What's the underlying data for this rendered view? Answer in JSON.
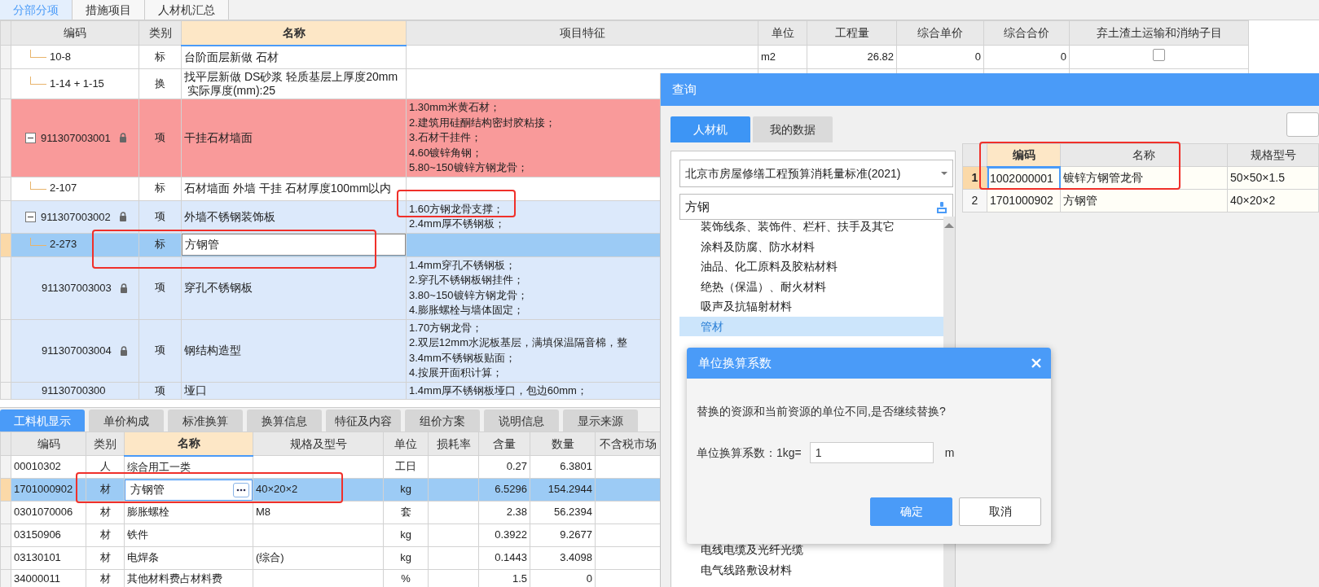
{
  "top_tabs": [
    {
      "label": "分部分项",
      "selected": true
    },
    {
      "label": "措施项目",
      "selected": false
    },
    {
      "label": "人材机汇总",
      "selected": false
    }
  ],
  "main_grid": {
    "columns": [
      {
        "label": "编码",
        "highlighted": false
      },
      {
        "label": "类别",
        "highlighted": false
      },
      {
        "label": "名称",
        "highlighted": true
      },
      {
        "label": "项目特征",
        "highlighted": false
      },
      {
        "label": "单位",
        "highlighted": false
      },
      {
        "label": "工程量",
        "highlighted": false
      },
      {
        "label": "综合单价",
        "highlighted": false
      },
      {
        "label": "综合合价",
        "highlighted": false
      },
      {
        "label": "弃土渣土运输和消纳子目",
        "highlighted": false
      }
    ],
    "rows": [
      {
        "kind": "sub",
        "code": "10-8",
        "type": "标",
        "name": "台阶面层新做 石材",
        "unit": "m2",
        "quantity": "26.82",
        "unit_price": "0",
        "total_price": "0",
        "checked": false,
        "selected": false
      },
      {
        "kind": "sub",
        "code": "1-14 + 1-15",
        "type": "换",
        "name": "找平层新做 DS砂浆 轻质基层上厚度20mm\n 实际厚度(mm):25",
        "selected": false
      },
      {
        "kind": "item",
        "code": "911307003001",
        "type": "项",
        "name": "干挂石材墙面",
        "features": [
          "1.30mm米黄石材；",
          "2.建筑用硅酮结构密封胶粘接；",
          "3.石材干挂件；",
          "4.60镀锌角钢；",
          "5.80~150镀锌方钢龙骨；"
        ],
        "locked": true,
        "expanded": true,
        "color": "#f99a9a",
        "selected": false,
        "children": [
          {
            "kind": "sub",
            "code": "2-107",
            "type": "标",
            "name": "石材墙面 外墙 干挂 石材厚度100mm以内",
            "selected": false
          }
        ]
      },
      {
        "kind": "item",
        "code": "911307003002",
        "type": "项",
        "name": "外墙不锈钢装饰板",
        "features": [
          "1.60方钢龙骨支撑；",
          "2.4mm厚不锈钢板；"
        ],
        "locked": true,
        "expanded": true,
        "color": "#dce9fb",
        "selected": false,
        "children": [
          {
            "kind": "sub",
            "code": "2-273",
            "type": "标",
            "name": "方钢管",
            "editing": true,
            "selected": true
          }
        ]
      },
      {
        "kind": "item",
        "code": "911307003003",
        "type": "项",
        "name": "穿孔不锈钢板",
        "features": [
          "1.4mm穿孔不锈钢板；",
          "2.穿孔不锈钢板钢挂件；",
          "3.80~150镀锌方钢龙骨；",
          "4.膨胀螺栓与墙体固定；"
        ],
        "locked": true,
        "color": "#dce9fb",
        "selected": false
      },
      {
        "kind": "item",
        "code": "911307003004",
        "type": "项",
        "name": "钢结构造型",
        "features": [
          "1.70方钢龙骨；",
          "2.双层12mm水泥板基层，满填保温隔音棉，整",
          "3.4mm不锈钢板贴面；",
          "4.按展开面积计算；"
        ],
        "locked": true,
        "color": "#dce9fb",
        "selected": false
      },
      {
        "kind": "item",
        "code": "91130700300",
        "type": "项",
        "name": "垭口",
        "features": [
          "1.4mm厚不锈钢板垭口，包边60mm；"
        ],
        "color": "#dce9fb",
        "selected": false
      }
    ]
  },
  "detail_tabs": [
    {
      "label": "工料机显示",
      "selected": true
    },
    {
      "label": "单价构成",
      "selected": false
    },
    {
      "label": "标准换算",
      "selected": false
    },
    {
      "label": "换算信息",
      "selected": false
    },
    {
      "label": "特征及内容",
      "selected": false
    },
    {
      "label": "组价方案",
      "selected": false
    },
    {
      "label": "说明信息",
      "selected": false
    },
    {
      "label": "显示来源",
      "selected": false
    }
  ],
  "detail_grid": {
    "columns": [
      {
        "label": "编码",
        "highlighted": false
      },
      {
        "label": "类别",
        "highlighted": false
      },
      {
        "label": "名称",
        "highlighted": true
      },
      {
        "label": "规格及型号",
        "highlighted": false
      },
      {
        "label": "单位",
        "highlighted": false
      },
      {
        "label": "损耗率",
        "highlighted": false
      },
      {
        "label": "含量",
        "highlighted": false
      },
      {
        "label": "数量",
        "highlighted": false
      },
      {
        "label": "不含税市场",
        "highlighted": false
      }
    ],
    "rows": [
      {
        "code": "00010302",
        "type": "人",
        "name": "综合用工一类",
        "unit": "工日",
        "content": "0.27",
        "quantity": "6.3801",
        "selected": false
      },
      {
        "code": "1701000902",
        "type": "材",
        "name": "方钢管",
        "spec": "40×20×2",
        "unit": "kg",
        "content": "6.5296",
        "quantity": "154.2944",
        "editing": true,
        "selected": true
      },
      {
        "code": "0301070006",
        "type": "材",
        "name": "膨胀螺栓",
        "spec": "M8",
        "unit": "套",
        "content": "2.38",
        "quantity": "56.2394",
        "selected": false
      },
      {
        "code": "03150906",
        "type": "材",
        "name": "铁件",
        "unit": "kg",
        "content": "0.3922",
        "quantity": "9.2677",
        "selected": false
      },
      {
        "code": "03130101",
        "type": "材",
        "name": "电焊条",
        "spec": "(综合)",
        "unit": "kg",
        "content": "0.1443",
        "quantity": "3.4098",
        "selected": false
      },
      {
        "code": "34000011",
        "type": "材",
        "name": "其他材料费占材料费",
        "unit": "%",
        "content": "1.5",
        "quantity": "0",
        "selected": false
      }
    ]
  },
  "query_dialog": {
    "title": "查询",
    "tabs": [
      {
        "label": "人材机",
        "selected": true
      },
      {
        "label": "我的数据",
        "selected": false
      }
    ],
    "library": "北京市房屋修缮工程预算消耗量标准(2021)",
    "search": "方钢",
    "categories_above": [
      {
        "label": "装饰线条、装饰件、栏杆、扶手及其它",
        "selected": false
      },
      {
        "label": "涂料及防腐、防水材料",
        "selected": false
      },
      {
        "label": "油品、化工原料及胶粘材料",
        "selected": false
      },
      {
        "label": "绝热（保温）、耐火材料",
        "selected": false
      },
      {
        "label": "吸声及抗辐射材料",
        "selected": false
      },
      {
        "label": "管材",
        "selected": true
      }
    ],
    "categories_below": [
      {
        "label": "电线电缆及光纤光缆",
        "selected": false
      },
      {
        "label": "电气线路敷设材料",
        "selected": false
      }
    ],
    "columns": [
      {
        "label": "编码",
        "highlighted": true
      },
      {
        "label": "名称",
        "highlighted": false
      },
      {
        "label": "规格型号",
        "highlighted": false
      }
    ],
    "rows": [
      {
        "index": "1",
        "code": "1002000001",
        "name": "镀锌方钢管龙骨",
        "spec": "50×50×1.5",
        "selected": true
      },
      {
        "index": "2",
        "code": "1701000902",
        "name": "方钢管",
        "spec": "40×20×2",
        "selected": false
      }
    ]
  },
  "unit_dialog": {
    "title": "单位换算系数",
    "message": "替换的资源和当前资源的单位不同,是否继续替换?",
    "label": "单位换算系数：1kg=",
    "value": "1",
    "unit": "m",
    "buttons": [
      {
        "label": "确定",
        "kind": "primary"
      },
      {
        "label": "取消",
        "kind": "secondary"
      }
    ]
  }
}
